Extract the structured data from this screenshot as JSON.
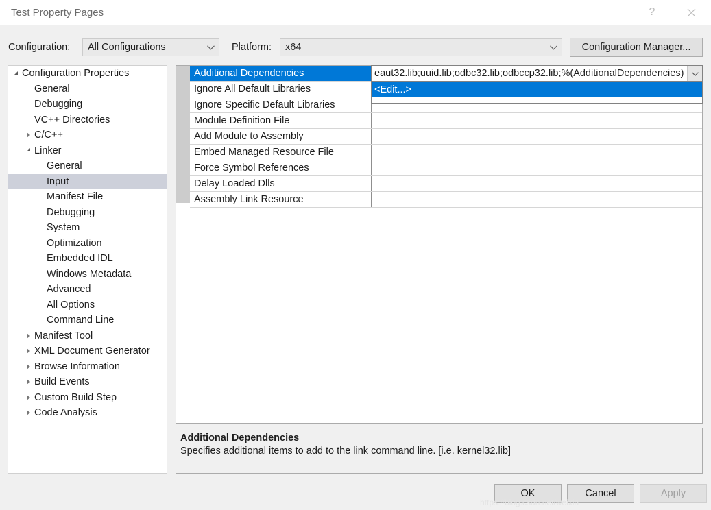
{
  "window": {
    "title": "Test Property Pages",
    "help_icon": "question-mark-icon",
    "close_icon": "close-icon"
  },
  "toolbar": {
    "configuration_label": "Configuration:",
    "configuration_value": "All Configurations",
    "platform_label": "Platform:",
    "platform_value": "x64",
    "configuration_manager_label": "Configuration Manager..."
  },
  "tree": {
    "items": [
      {
        "label": "Configuration Properties",
        "indent": 0,
        "state": "expanded"
      },
      {
        "label": "General",
        "indent": 1,
        "state": "leaf"
      },
      {
        "label": "Debugging",
        "indent": 1,
        "state": "leaf"
      },
      {
        "label": "VC++ Directories",
        "indent": 1,
        "state": "leaf"
      },
      {
        "label": "C/C++",
        "indent": 1,
        "state": "collapsed"
      },
      {
        "label": "Linker",
        "indent": 1,
        "state": "expanded"
      },
      {
        "label": "General",
        "indent": 2,
        "state": "leaf"
      },
      {
        "label": "Input",
        "indent": 2,
        "state": "leaf",
        "selected": true
      },
      {
        "label": "Manifest File",
        "indent": 2,
        "state": "leaf"
      },
      {
        "label": "Debugging",
        "indent": 2,
        "state": "leaf"
      },
      {
        "label": "System",
        "indent": 2,
        "state": "leaf"
      },
      {
        "label": "Optimization",
        "indent": 2,
        "state": "leaf"
      },
      {
        "label": "Embedded IDL",
        "indent": 2,
        "state": "leaf"
      },
      {
        "label": "Windows Metadata",
        "indent": 2,
        "state": "leaf"
      },
      {
        "label": "Advanced",
        "indent": 2,
        "state": "leaf"
      },
      {
        "label": "All Options",
        "indent": 2,
        "state": "leaf"
      },
      {
        "label": "Command Line",
        "indent": 2,
        "state": "leaf"
      },
      {
        "label": "Manifest Tool",
        "indent": 1,
        "state": "collapsed"
      },
      {
        "label": "XML Document Generator",
        "indent": 1,
        "state": "collapsed"
      },
      {
        "label": "Browse Information",
        "indent": 1,
        "state": "collapsed"
      },
      {
        "label": "Build Events",
        "indent": 1,
        "state": "collapsed"
      },
      {
        "label": "Custom Build Step",
        "indent": 1,
        "state": "collapsed"
      },
      {
        "label": "Code Analysis",
        "indent": 1,
        "state": "collapsed"
      }
    ]
  },
  "grid": {
    "rows": [
      {
        "name": "Additional Dependencies",
        "value": "",
        "selected": true
      },
      {
        "name": "Ignore All Default Libraries",
        "value": ""
      },
      {
        "name": "Ignore Specific Default Libraries",
        "value": ""
      },
      {
        "name": "Module Definition File",
        "value": ""
      },
      {
        "name": "Add Module to Assembly",
        "value": ""
      },
      {
        "name": "Embed Managed Resource File",
        "value": ""
      },
      {
        "name": "Force Symbol References",
        "value": ""
      },
      {
        "name": "Delay Loaded Dlls",
        "value": ""
      },
      {
        "name": "Assembly Link Resource",
        "value": ""
      }
    ]
  },
  "editor": {
    "value": "eaut32.lib;uuid.lib;odbc32.lib;odbccp32.lib;%(AdditionalDependencies)",
    "dropdown_icon": "chevron-down-icon",
    "options": [
      {
        "label": "<Edit...>",
        "highlighted": true
      }
    ]
  },
  "description": {
    "title": "Additional Dependencies",
    "text": "Specifies additional items to add to the link command line. [i.e. kernel32.lib]"
  },
  "footer": {
    "ok_label": "OK",
    "cancel_label": "Cancel",
    "apply_label": "Apply"
  },
  "watermark": {
    "text": "https://blog.csdn.net/weixin"
  },
  "colors": {
    "accent": "#0078D7",
    "tree_selection": "#CDD0DA",
    "dialog_background": "#F0F0F0",
    "panel_background": "#FFFFFF"
  }
}
